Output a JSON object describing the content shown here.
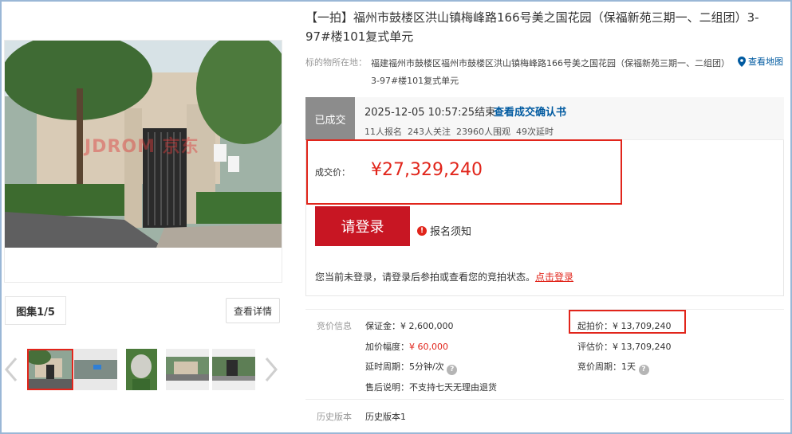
{
  "title": "【一拍】福州市鼓楼区洪山镇梅峰路166号美之国花园（保福新苑三期一、二组团）3-97#楼101复式单元",
  "location": {
    "label": "标的物所在地：",
    "text": "福建福州市鼓楼区福州市鼓楼区洪山镇梅峰路166号美之国花园（保福新苑三期一、二组团）3-97#楼101复式单元",
    "map_link": "查看地图"
  },
  "gallery": {
    "watermark": "JDROM 京东",
    "label": "图集1/5",
    "detail_button": "查看详情",
    "thumbnail_count": 5,
    "selected_index": 0
  },
  "status": {
    "tag": "已成交",
    "end_time": "2025-12-05 10:57:25结束",
    "confirm_link": "查看成交确认书",
    "stats": "11人报名  243人关注  23960人围观  49次延时"
  },
  "deal": {
    "label": "成交价：",
    "price": "¥27,329,240"
  },
  "login_button": "请登录",
  "notice": "报名须知",
  "hint": {
    "text": "您当前未登录，请登录后参拍或查看您的竞拍状态。",
    "link": "点击登录"
  },
  "bid_info": {
    "label": "竞价信息",
    "deposit": "保证金：¥ 2,600,000",
    "increment_label": "加价幅度：",
    "increment_value": "¥ 60,000",
    "delay_period": "延时周期：5分钟/次",
    "after_sale": "售后说明：不支持七天无理由退货",
    "start_price": "起拍价：¥ 13,709,240",
    "appraisal": "评估价：¥ 13,709,240",
    "bid_period": "竞价周期：1天"
  },
  "history": {
    "label": "历史版本",
    "value": "历史版本1"
  },
  "colors": {
    "accent_red": "#e1251b",
    "button_red": "#c81623",
    "link_blue": "#005aa0",
    "status_gray": "#8c8c8c"
  }
}
